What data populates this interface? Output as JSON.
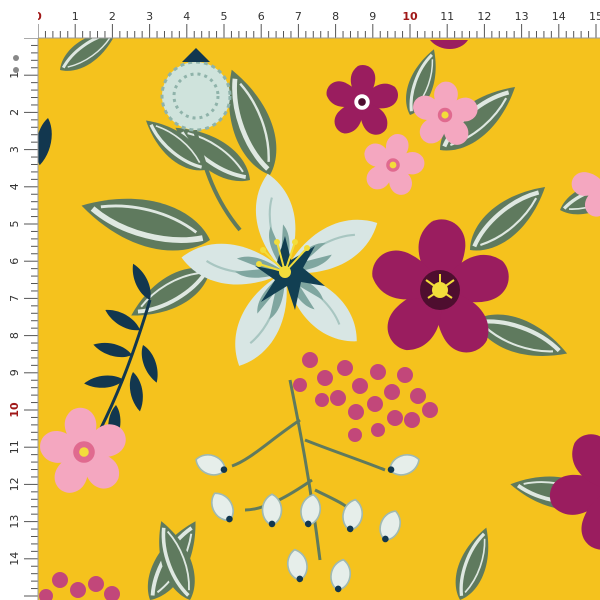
{
  "colors": {
    "background": "#f5c21d",
    "ruler": "#ffffff",
    "ruler_tick": "#555555",
    "ruler_highlight": "#a01818",
    "leaf_dark": "#5f7a5e",
    "leaf_light": "#dfe8e1",
    "hibiscus_petal": "#d8e6e4",
    "hibiscus_shadow": "#7fa6a0",
    "hibiscus_center": "#123f52",
    "magenta": "#9a1d5f",
    "pink": "#f4a7c0",
    "berry": "#c2477a",
    "navy_leaf": "#12374f",
    "stamen": "#f3dd3b"
  },
  "ruler": {
    "top_labels": [
      "0",
      "1",
      "2",
      "3",
      "4",
      "5",
      "6",
      "7",
      "8",
      "9",
      "10",
      "11",
      "12",
      "13",
      "14",
      "15"
    ],
    "left_labels": [
      "1",
      "2",
      "3",
      "4",
      "5",
      "6",
      "7",
      "8",
      "9",
      "10",
      "11",
      "12",
      "13",
      "14"
    ],
    "highlighted": [
      "0",
      "10"
    ]
  },
  "motifs": [
    "light-blue-hibiscus",
    "magenta-flower",
    "pink-flower",
    "protea-bud",
    "white-buds",
    "berry-cluster",
    "navy-leaves",
    "green-leaves"
  ]
}
